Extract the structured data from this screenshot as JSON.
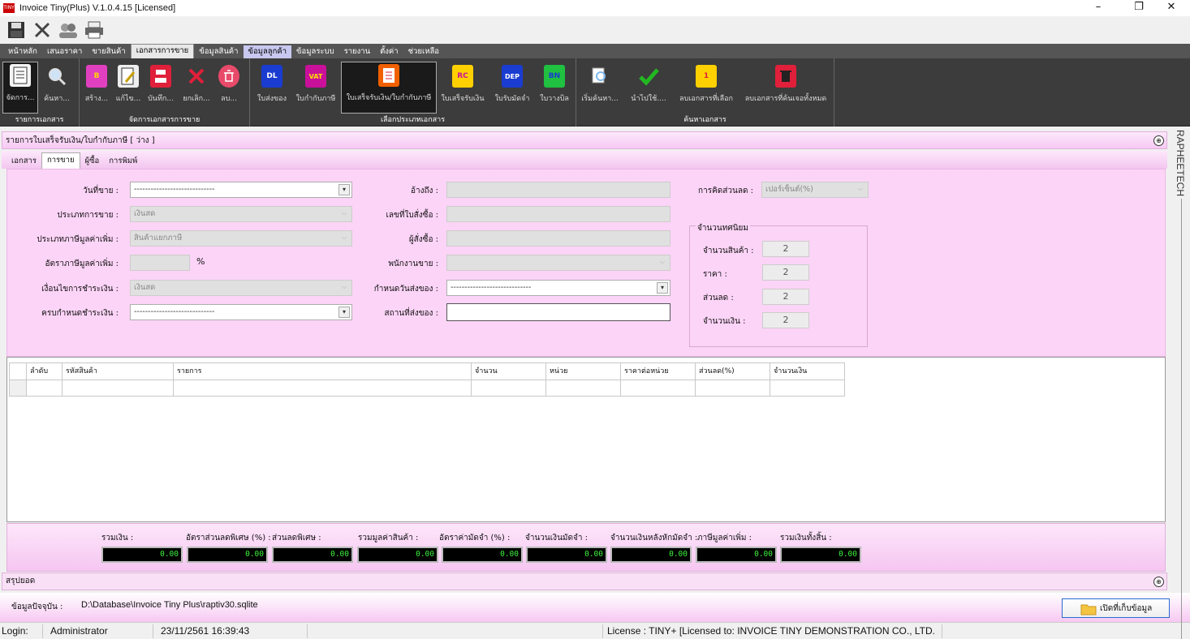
{
  "app": {
    "title": "Invoice Tiny(Plus)  V.1.0.4.15 [Licensed]",
    "icon_text": "TINY"
  },
  "window_controls": {
    "minimize": "–",
    "maximize": "❐",
    "close": "✕"
  },
  "quick_toolbar": [
    "save-icon",
    "close-icon",
    "users-icon",
    "printer-icon"
  ],
  "menu": {
    "items": [
      "หน้าหลัก",
      "เสนอราคา",
      "ขายสินค้า",
      "เอกสารการขาย",
      "ข้อมูลสินค้า",
      "ข้อมูลลูกค้า",
      "ข้อมูลระบบ",
      "รายงาน",
      "ตั้งค่า",
      "ช่วยเหลือ"
    ],
    "active_index": 3,
    "highlight_index": 5
  },
  "ribbon": {
    "groups": [
      {
        "title": "รายการเอกสาร",
        "buttons": [
          "จัดการ...",
          "ค้นหา..."
        ]
      },
      {
        "title": "จัดการเอกสารการขาย",
        "buttons": [
          "สร้าง...",
          "แก้ไข...",
          "บันทึก...",
          "ยกเลิก...",
          "ลบ..."
        ]
      },
      {
        "title": "เลือกประเภทเอกสาร",
        "buttons": [
          "ใบส่งของ",
          "ใบกำกับภาษี",
          "ใบเสร็จรับเงิน/ใบกำกับภาษี",
          "ใบเสร็จรับเงิน",
          "ใบรับมัดจำ",
          "ใบวางบิล"
        ]
      },
      {
        "title": "ค้นหาเอกสาร",
        "buttons": [
          "เริ่มค้นหา...",
          "นำไปใช้....",
          "ลบเอกสารที่เลือก",
          "ลบเอกสารที่ค้นเจอทั้งหมด"
        ]
      }
    ],
    "icon_texts": {
      "dl": "DL",
      "vat": "VAT",
      "rc": "RC",
      "dep": "DEP",
      "bn": "BN"
    },
    "colors": {
      "bg": "#3c3c3c",
      "accent_red": "#e0203a",
      "check_green": "#22b822"
    }
  },
  "section": {
    "title": "รายการใบเสร็จรับเงิน/ใบกำกับภาษี [  ว่าง ]",
    "collapse_symbol": "⊕"
  },
  "tabs": [
    "เอกสาร",
    "การขาย",
    "ผู้ซื้อ",
    "การพิมพ์"
  ],
  "tab_active_index": 1,
  "form": {
    "sale_date": {
      "label": "วันที่ขาย :",
      "value": "-----------------------------"
    },
    "sale_type": {
      "label": "ประเภทการขาย :",
      "value": "เงินสด"
    },
    "vat_type": {
      "label": "ประเภทภาษีมูลค่าเพิ่ม :",
      "value": "สินค้าแยกภาษี"
    },
    "vat_rate": {
      "label": "อัตราภาษีมูลค่าเพิ่ม :",
      "value": "",
      "unit": "%"
    },
    "payment_terms": {
      "label": "เงื่อนไขการชำระเงิน :",
      "value": "เงินสด"
    },
    "due_date": {
      "label": "ครบกำหนดชำระเงิน :",
      "value": "-----------------------------"
    },
    "reference": {
      "label": "อ้างถึง :",
      "value": ""
    },
    "po_number": {
      "label": "เลขที่ใบสั่งซื้อ :",
      "value": ""
    },
    "orderer": {
      "label": "ผู้สั่งซื้อ :",
      "value": ""
    },
    "salesperson": {
      "label": "พนักงานขาย :",
      "value": ""
    },
    "delivery_date": {
      "label": "กำหนดวันส่งของ :",
      "value": "-----------------------------"
    },
    "delivery_place": {
      "label": "สถานที่ส่งของ :",
      "value": ""
    },
    "discount_calc": {
      "label": "การคิดส่วนลด :",
      "value": "เปอร์เซ็นต์(%)"
    },
    "decimals": {
      "title": "จำนวนทศนิยม",
      "items": [
        {
          "label": "จำนวนสินค้า :",
          "value": "2"
        },
        {
          "label": "ราคา :",
          "value": "2"
        },
        {
          "label": "ส่วนลด :",
          "value": "2"
        },
        {
          "label": "จำนวนเงิน :",
          "value": "2"
        }
      ]
    }
  },
  "grid": {
    "columns": [
      "ลำดับ",
      "รหัสสินค้า",
      "รายการ",
      "จำนวน",
      "หน่วย",
      "ราคาต่อหน่วย",
      "ส่วนลด(%)",
      "จำนวนเงิน"
    ]
  },
  "totals": [
    {
      "label": "รวมเงิน :",
      "value": "0.00"
    },
    {
      "label": "อัตราส่วนลดพิเศษ (%) :",
      "value": "0.00"
    },
    {
      "label": "ส่วนลดพิเศษ :",
      "value": "0.00"
    },
    {
      "label": "รวมมูลค่าสินค้า :",
      "value": "0.00"
    },
    {
      "label": "อัตราค่ามัดจำ (%) :",
      "value": "0.00"
    },
    {
      "label": "จำนวนเงินมัดจำ :",
      "value": "0.00"
    },
    {
      "label": "จำนวนเงินหลังหักมัดจำ :",
      "value": "0.00"
    },
    {
      "label": "ภาษีมูลค่าเพิ่ม :",
      "value": "0.00"
    },
    {
      "label": "รวมเงินทั้งสิ้น :",
      "value": "0.00"
    }
  ],
  "summary": {
    "label": "สรุปยอด"
  },
  "database": {
    "label": "ข้อมูลปัจจุบัน :",
    "path": "D:\\Database\\Invoice Tiny Plus\\raptiv30.sqlite",
    "open_button": "เปิดที่เก็บข้อมูล"
  },
  "status": {
    "login_label": "Login:",
    "user": "Administrator",
    "datetime": "23/11/2561 16:39:43",
    "license": "License : TINY+ [Licensed to: INVOICE TINY DEMONSTRATION CO., LTD."
  },
  "brand": "RAPHEETECH"
}
